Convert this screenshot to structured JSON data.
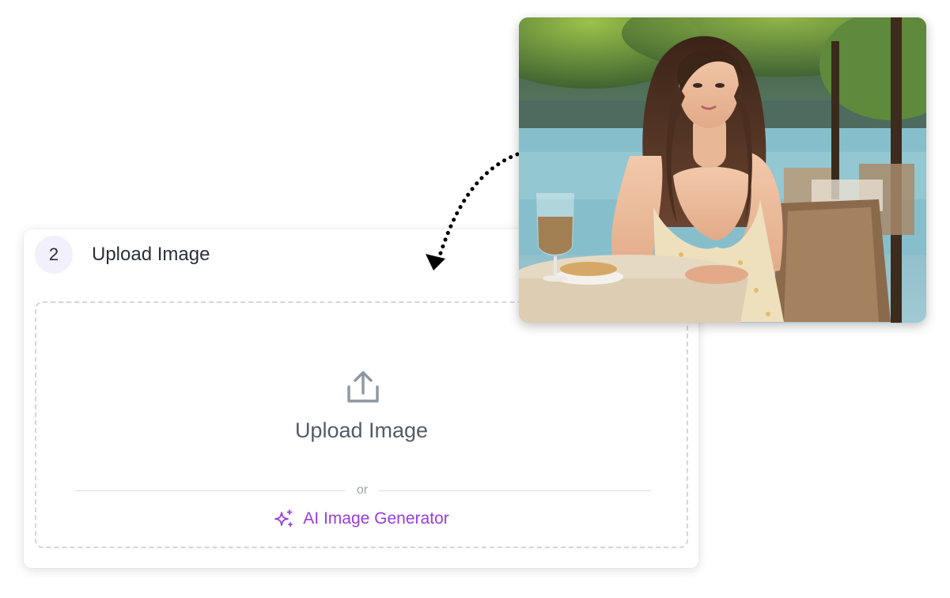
{
  "upload_step": {
    "step_number": "2",
    "title": "Upload Image",
    "dropzone": {
      "label": "Upload Image",
      "icon": "upload-icon",
      "divider_text": "or",
      "ai_generator_label": "AI Image Generator",
      "ai_generator_icon": "sparkle-icon"
    }
  },
  "example_image": {
    "subject": "woman-at-lakeside-cafe-table-photo"
  },
  "colors": {
    "accent_purple": "#9a3ce0",
    "badge_bg": "#f1f0fb",
    "dashed_border": "#d3d5dc"
  }
}
